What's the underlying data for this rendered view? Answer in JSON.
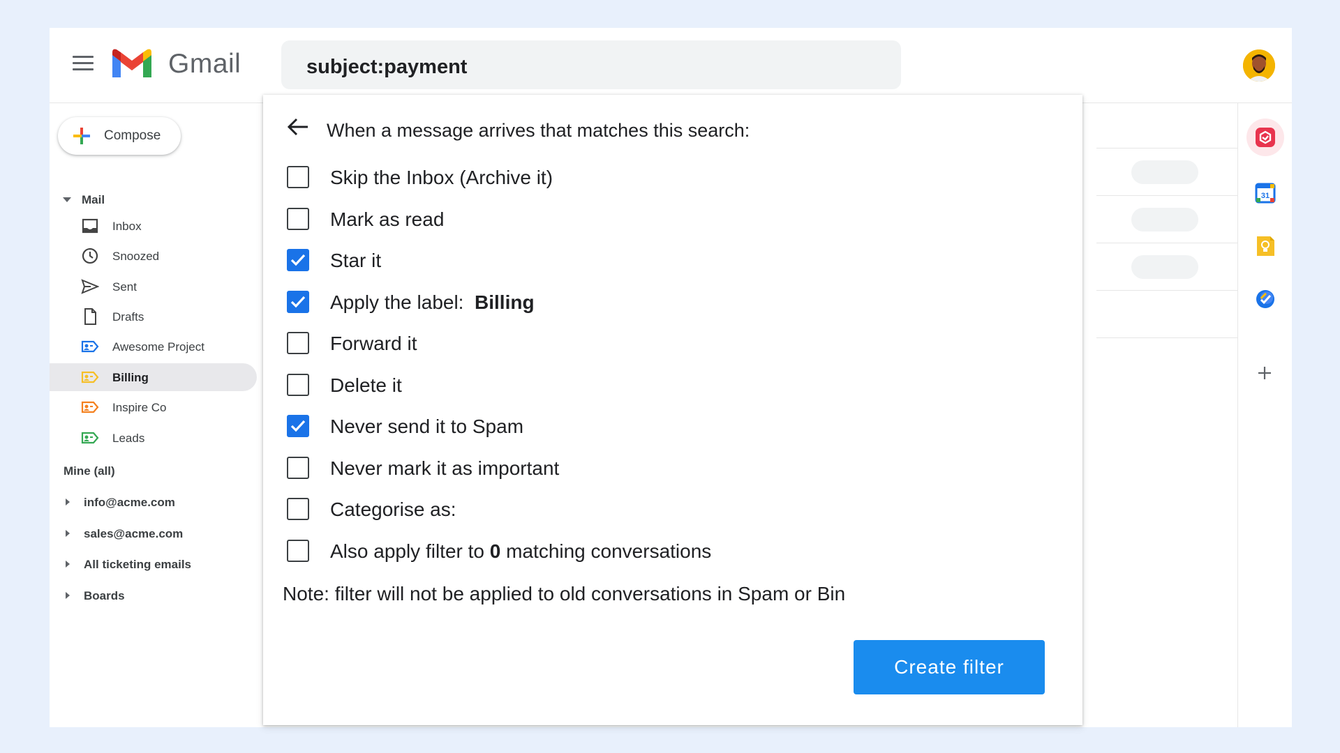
{
  "app": {
    "name": "Gmail"
  },
  "search": {
    "query": "subject:payment"
  },
  "sidebar": {
    "compose_label": "Compose",
    "mail_section": "Mail",
    "items": [
      {
        "label": "Inbox",
        "icon": "inbox-icon"
      },
      {
        "label": "Snoozed",
        "icon": "clock-icon"
      },
      {
        "label": "Sent",
        "icon": "send-icon"
      },
      {
        "label": "Drafts",
        "icon": "draft-icon"
      },
      {
        "label": "Awesome Project",
        "icon": "label-icon",
        "color": "#1a73e8"
      },
      {
        "label": "Billing",
        "icon": "label-icon",
        "color": "#f6bf26",
        "active": true
      },
      {
        "label": "Inspire Co",
        "icon": "label-icon",
        "color": "#f4811f"
      },
      {
        "label": "Leads",
        "icon": "label-icon",
        "color": "#34a853"
      }
    ],
    "mine_section": "Mine (all)",
    "accounts": [
      {
        "label": "info@acme.com"
      },
      {
        "label": "sales@acme.com"
      },
      {
        "label": "All ticketing emails"
      },
      {
        "label": "Boards"
      }
    ]
  },
  "rail": {
    "apps": [
      {
        "icon": "hiver-icon",
        "color": "#e8344e"
      },
      {
        "icon": "calendar-icon",
        "color": "#1a73e8",
        "text": "31"
      },
      {
        "icon": "keep-icon",
        "color": "#f6bf26"
      },
      {
        "icon": "tasks-icon",
        "color": "#1a73e8"
      }
    ],
    "add_icon": "plus-icon"
  },
  "filter": {
    "title": "When a message arrives that matches this search:",
    "options": [
      {
        "label": "Skip the Inbox (Archive it)",
        "checked": false
      },
      {
        "label": "Mark as read",
        "checked": false
      },
      {
        "label": "Star it",
        "checked": true
      },
      {
        "label": "Apply the label:",
        "value": "Billing",
        "checked": true
      },
      {
        "label": "Forward it",
        "checked": false
      },
      {
        "label": "Delete it",
        "checked": false
      },
      {
        "label": "Never send it to Spam",
        "checked": true
      },
      {
        "label": "Never mark it as important",
        "checked": false
      },
      {
        "label": "Categorise as:",
        "checked": false
      },
      {
        "label_before": "Also apply filter to",
        "count": "0",
        "label_after": "matching conversations",
        "checked": false
      }
    ],
    "note": "Note: filter will not be applied to old conversations in Spam or Bin",
    "create_button": "Create filter"
  },
  "colors": {
    "primary": "#1a73e8",
    "button": "#1a8cee"
  }
}
